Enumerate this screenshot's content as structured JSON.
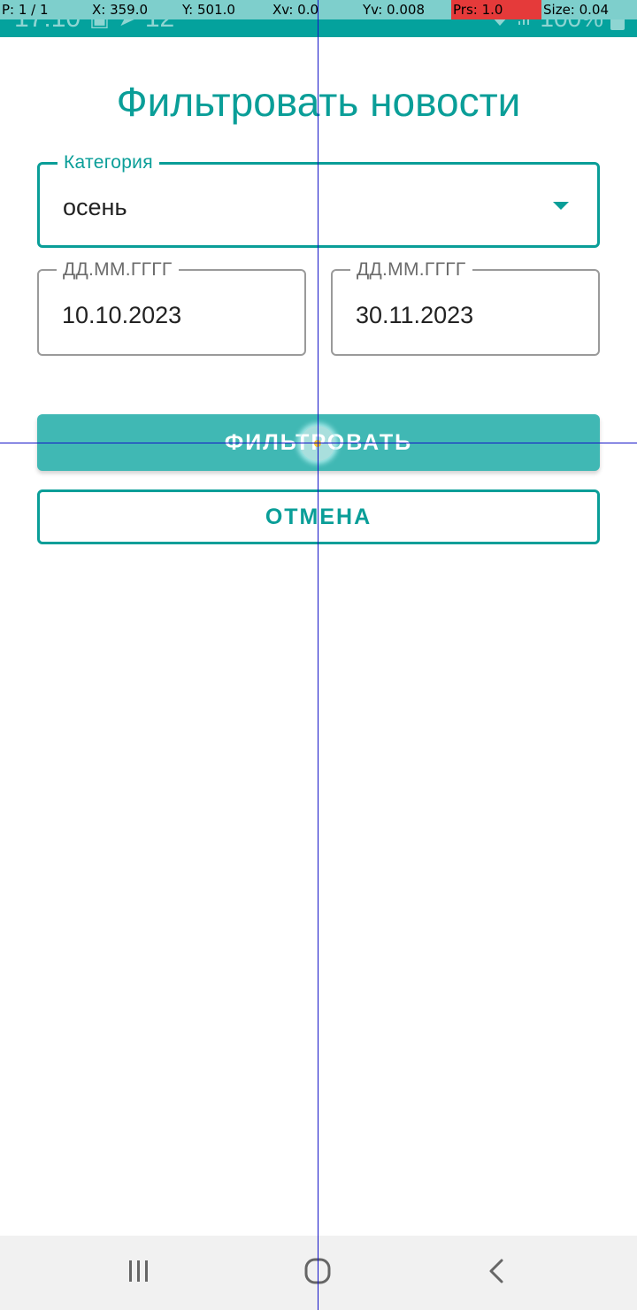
{
  "status_bar": {
    "time": "17:10",
    "notification_count": "12",
    "battery_percent": "100%",
    "icons": [
      "gallery-icon",
      "telegram-icon",
      "wifi-icon",
      "signal-icon",
      "battery-icon"
    ]
  },
  "pointer_overlay": {
    "pointer": "P: 1 / 1",
    "x": "X: 359.0",
    "y": "Y: 501.0",
    "xv": "Xv: 0.0",
    "yv": "Yv: 0.008",
    "pressure": "Prs: 1.0",
    "size": "Size: 0.04"
  },
  "title": "Фильтровать новости",
  "category": {
    "label": "Категория",
    "value": "осень",
    "icon": "dropdown-arrow-icon"
  },
  "date_from": {
    "label": "ДД.ММ.ГГГГ",
    "value": "10.10.2023"
  },
  "date_to": {
    "label": "ДД.ММ.ГГГГ",
    "value": "30.11.2023"
  },
  "buttons": {
    "filter": "ФИЛЬТРОВАТЬ",
    "cancel": "ОТМЕНА"
  },
  "nav_bar": {
    "icons": [
      "recents-icon",
      "home-icon",
      "back-icon"
    ]
  },
  "colors": {
    "accent": "#0a9e98",
    "status_bar": "#04a29d",
    "filter_button": "#40b8b4",
    "field_border_inactive": "#9a9a9a",
    "nav_bar": "#f1f1f1"
  }
}
